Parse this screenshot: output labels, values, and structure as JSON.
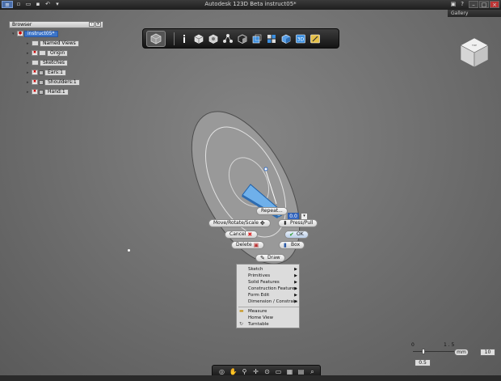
{
  "app": {
    "title": "Autodesk 123D Beta   instruct05*",
    "gallery_label": "Gallery",
    "sign_in_label": "Sign In"
  },
  "browser": {
    "title": "Browser",
    "items": [
      {
        "label": "instruct05*"
      },
      {
        "label": "Named Views"
      },
      {
        "label": "Origin"
      },
      {
        "label": "Sketches"
      },
      {
        "label": "Ears:1"
      },
      {
        "label": "Shoulders:1"
      },
      {
        "label": "Hand:1"
      }
    ]
  },
  "toolbar": {
    "icons": [
      "home-view-icon",
      "info-icon",
      "box-icon",
      "primitive-icon",
      "pattern-icon",
      "surface-icon",
      "solid-icon",
      "grid-icon",
      "cube-icon",
      "3d-icon",
      "edit-icon"
    ]
  },
  "marking_menu": {
    "repeat": "Repeat...",
    "move": "Move/Rotate/Scale",
    "press_pull": "Press/Pull",
    "cancel": "Cancel",
    "ok": "OK",
    "delete": "Delete",
    "box": "Box",
    "draw": "Draw",
    "value": "0.0"
  },
  "context_menu": {
    "items": [
      {
        "label": "Sketch",
        "submenu": true
      },
      {
        "label": "Primitives",
        "submenu": true
      },
      {
        "label": "Solid Features",
        "submenu": true
      },
      {
        "label": "Construction Features",
        "submenu": true
      },
      {
        "label": "Form Edit",
        "submenu": true
      },
      {
        "label": "Dimension / Constrain",
        "submenu": true
      },
      {
        "label": "Measure",
        "submenu": false
      },
      {
        "label": "Home View",
        "submenu": false
      },
      {
        "label": "Turntable",
        "submenu": false
      }
    ]
  },
  "scale": {
    "left_tick": "0",
    "right_tick": "1 . 5",
    "unit": "mm",
    "grid_value": "10",
    "snap_value": "0.5"
  },
  "colors": {
    "accent": "#3b74c9",
    "shape_fill": "#6fa9e0",
    "viewport": "#7a7a7a"
  }
}
